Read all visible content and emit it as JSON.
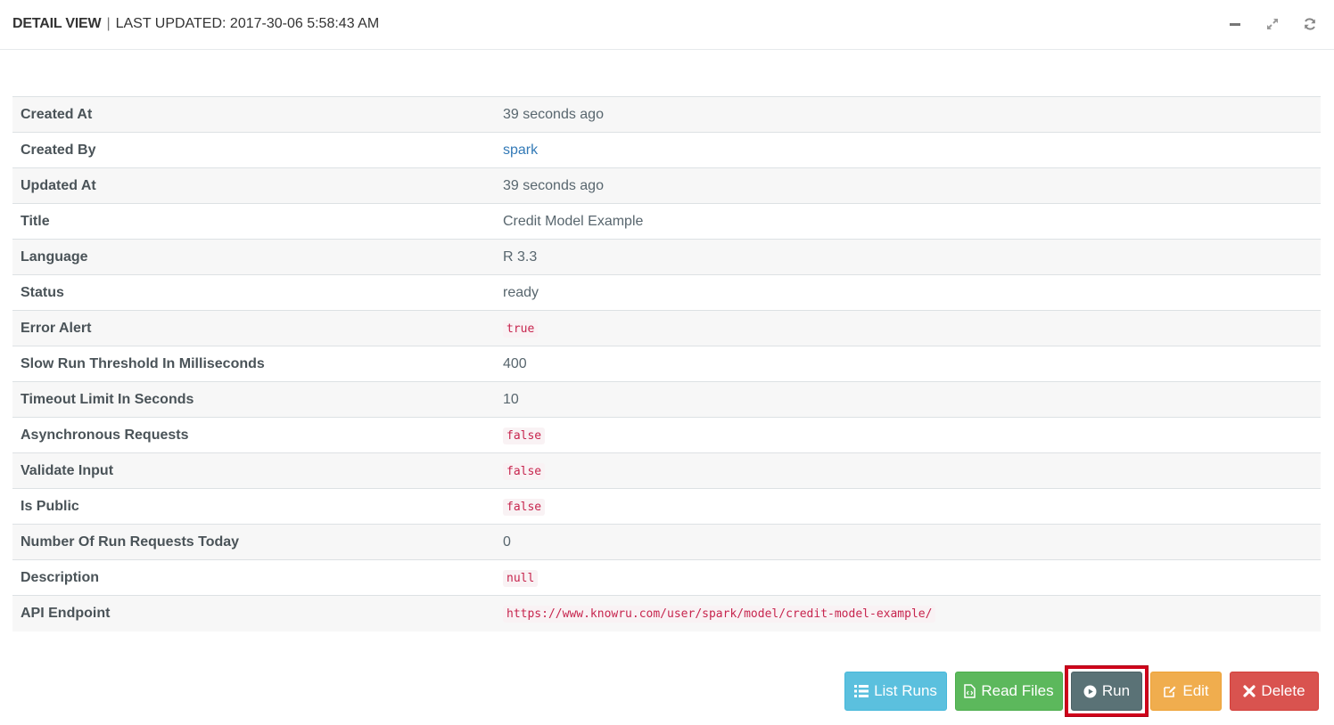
{
  "header": {
    "title": "DETAIL VIEW",
    "separator": "|",
    "updated": "LAST UPDATED: 2017-30-06 5:58:43 AM",
    "tools": [
      "minimize-icon",
      "expand-icon",
      "refresh-icon"
    ]
  },
  "details": {
    "rows": [
      {
        "label": "Created At",
        "value": "39 seconds ago"
      },
      {
        "label": "Created By",
        "value": "spark"
      },
      {
        "label": "Updated At",
        "value": "39 seconds ago"
      },
      {
        "label": "Title",
        "value": "Credit Model Example"
      },
      {
        "label": "Language",
        "value": "R 3.3"
      },
      {
        "label": "Status",
        "value": "ready"
      },
      {
        "label": "Error Alert",
        "value": "true"
      },
      {
        "label": "Slow Run Threshold In Milliseconds",
        "value": "400"
      },
      {
        "label": "Timeout Limit In Seconds",
        "value": "10"
      },
      {
        "label": "Asynchronous Requests",
        "value": "false"
      },
      {
        "label": "Validate Input",
        "value": "false"
      },
      {
        "label": "Is Public",
        "value": "false"
      },
      {
        "label": "Number Of Run Requests Today",
        "value": "0"
      },
      {
        "label": "Description",
        "value": "null"
      },
      {
        "label": "API Endpoint",
        "value": "https://www.knowru.com/user/spark/model/credit-model-example/"
      }
    ]
  },
  "actions": {
    "list_runs": "List Runs",
    "read_files": "Read Files",
    "run": "Run",
    "edit": "Edit",
    "delete": "Delete"
  },
  "colors": {
    "info": "#5bc0de",
    "success": "#5cb85c",
    "run": "#5a7276",
    "warning": "#f0ad4e",
    "danger": "#d9534f",
    "highlight": "#d0021b",
    "code": "#c7254e",
    "link": "#337ab7"
  }
}
